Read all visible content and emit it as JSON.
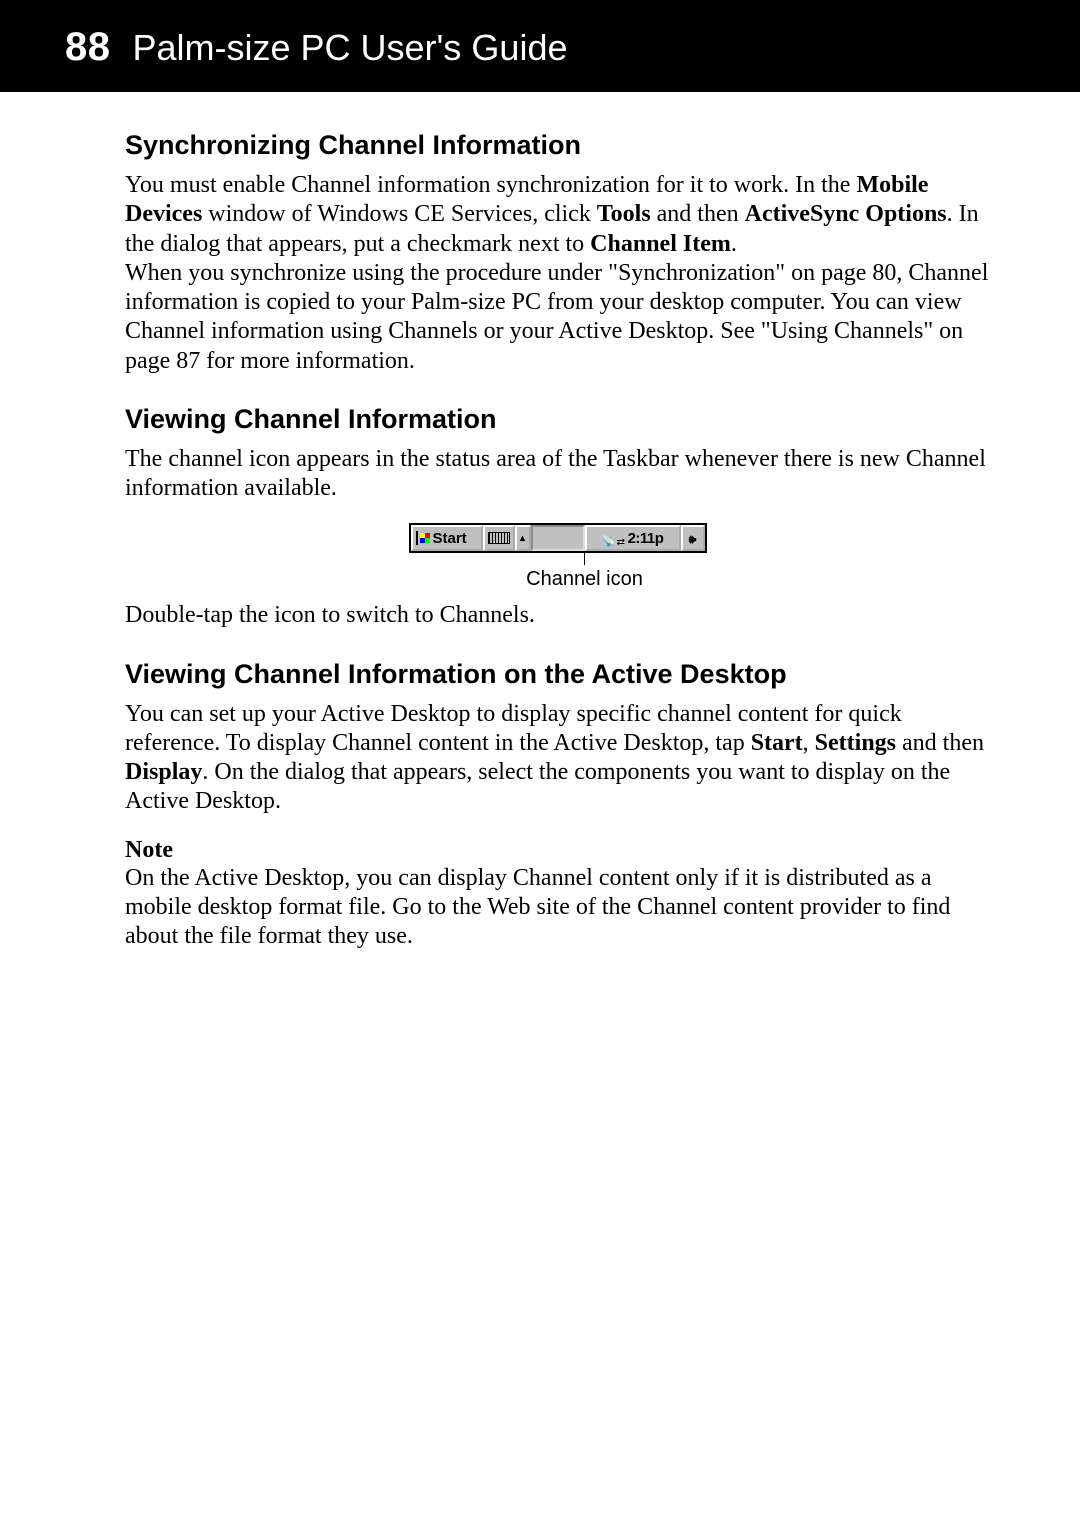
{
  "header": {
    "page_number": "88",
    "book_title": "Palm-size PC User's Guide"
  },
  "section1": {
    "heading": "Synchronizing Channel Information",
    "para": {
      "t1": "You must enable Channel information synchronization for it to work. In the ",
      "b1": "Mobile Devices",
      "t2": " window of Windows CE Services, click ",
      "b2": "Tools",
      "t3": " and then ",
      "b3": "ActiveSync Options",
      "t4": ". In the dialog that appears, put a checkmark next to ",
      "b4": "Channel Item",
      "t5": ".",
      "t6": "When you synchronize using the procedure under \"Synchronization\" on page 80, Channel information is copied to your Palm-size PC from your desktop computer.  You can view Channel information using Channels or your Active Desktop. See \"Using Channels\" on page 87 for more information."
    }
  },
  "section2": {
    "heading": "Viewing Channel Information",
    "para1": "The channel icon appears in the status area of the Taskbar whenever there is new Channel information available.",
    "taskbar": {
      "start_label": "Start",
      "time": "2:11p",
      "caption": "Channel icon"
    },
    "para2": "Double-tap the icon to switch to Channels."
  },
  "section3": {
    "heading": "Viewing Channel Information on the Active Desktop",
    "para": {
      "t1": "You can set up your Active Desktop to display specific channel content for quick reference. To display Channel content in the Active Desktop, tap ",
      "b1": "Start",
      "t2": ", ",
      "b2": "Settings",
      "t3": " and then ",
      "b3": "Display",
      "t4": ". On the dialog that appears, select the components you want to display on the Active Desktop."
    },
    "note_label": "Note",
    "note_body": "On the Active Desktop, you can display Channel content only if it is distributed as a mobile desktop format file. Go to the Web site of the Channel content provider to find about the file format they use."
  }
}
